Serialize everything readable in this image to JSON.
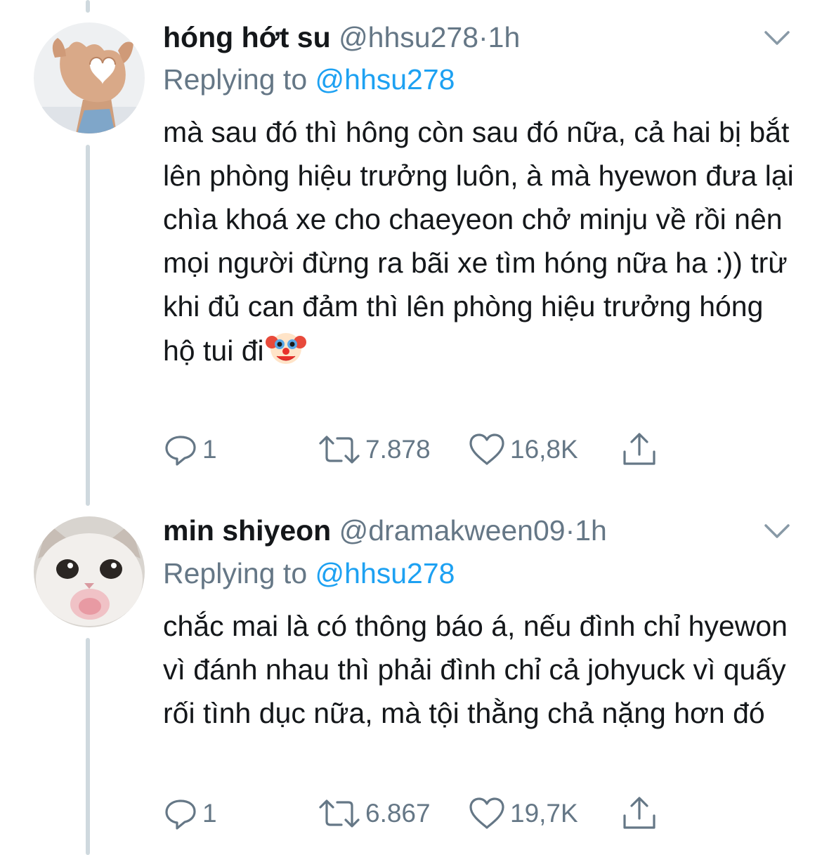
{
  "tweets": [
    {
      "display_name": "hóng hớt su",
      "handle": "@hhsu278",
      "separator": "·",
      "time": "1h",
      "reply_label": "Replying to",
      "reply_to": "@hhsu278",
      "body": "mà sau đó thì hông còn sau đó nữa, cả hai bị bắt lên phòng hiệu trưởng luôn, à mà hyewon đưa lại chìa khoá xe cho chaeyeon chở minju về rồi nên mọi người đừng ra bãi xe tìm hóng nữa ha :)) trừ khi đủ can đảm thì lên phòng hiệu trưởng hóng hộ tui đi",
      "body_emoji": "clown-face-emoji",
      "avatar": "hand-heart-avatar",
      "replies": "1",
      "retweets": "7.878",
      "likes": "16,8K"
    },
    {
      "display_name": "min shiyeon",
      "handle": "@dramakween09",
      "separator": "·",
      "time": "1h",
      "reply_label": "Replying to",
      "reply_to": "@hhsu278",
      "body": "chắc mai là có thông báo á, nếu đình chỉ hyewon vì đánh nhau thì phải đình chỉ cả johyuck vì quấy rối tình dục nữa, mà tội thằng chả nặng hơn đó",
      "avatar": "crying-cat-avatar",
      "replies": "1",
      "retweets": "6.867",
      "likes": "19,7K"
    }
  ],
  "colors": {
    "text": "#14171a",
    "secondary": "#657786",
    "link": "#1da1f2",
    "thread_line": "#cfd9de"
  },
  "icons": [
    "reply-icon",
    "retweet-icon",
    "like-icon",
    "share-icon",
    "chevron-down-icon"
  ]
}
